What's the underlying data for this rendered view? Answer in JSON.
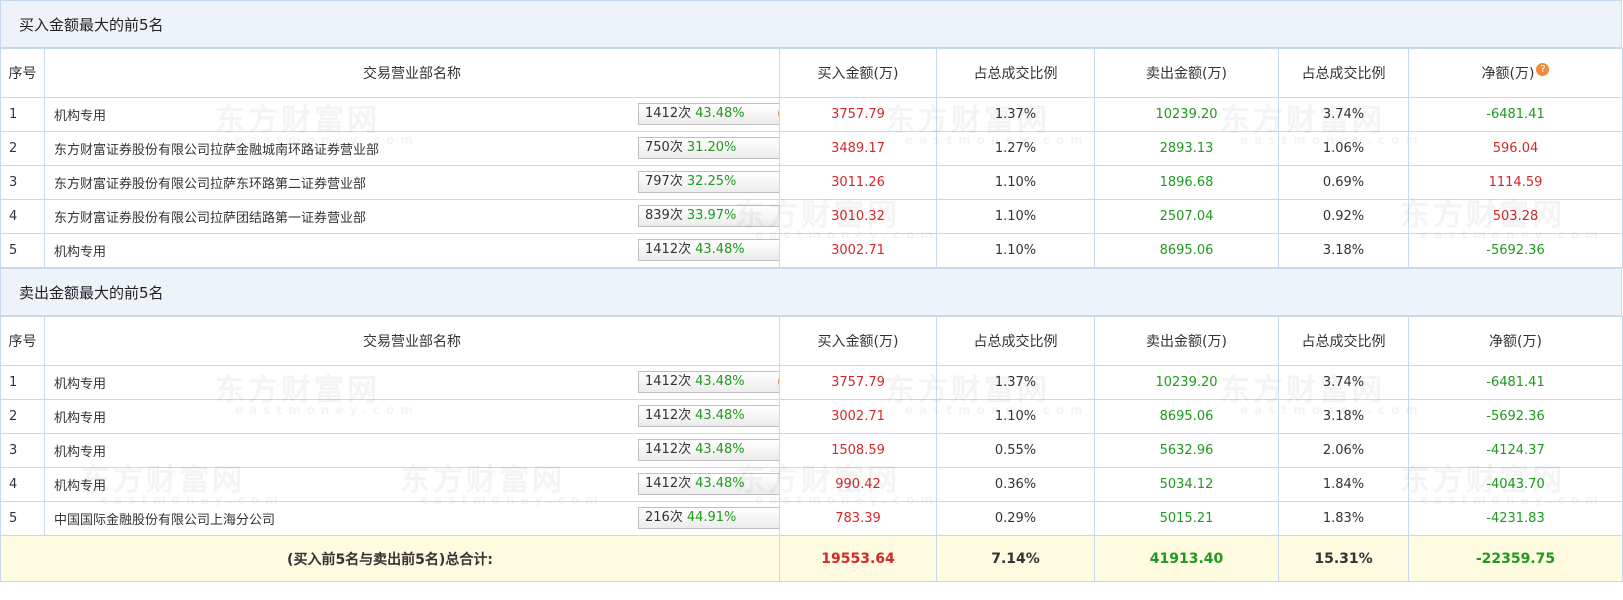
{
  "buy_section": {
    "title": "买入金额最大的前5名",
    "headers": [
      "序号",
      "交易营业部名称",
      "买入金额(万)",
      "占总成交比例",
      "卖出金额(万)",
      "占总成交比例",
      "净额(万)"
    ],
    "net_help_icon": "question-icon",
    "rows": [
      {
        "idx": "1",
        "name": "机构专用",
        "count": "1412次",
        "pct": "43.48%",
        "icon": "question-icon",
        "buy": "3757.79",
        "buy_ratio": "1.37%",
        "sell": "10239.20",
        "sell_ratio": "3.74%",
        "net": "-6481.41",
        "net_color": "green"
      },
      {
        "idx": "2",
        "name": "东方财富证券股份有限公司拉萨金融城南环路证券营业部",
        "count": "750次",
        "pct": "31.20%",
        "icon": "play-icon",
        "buy": "3489.17",
        "buy_ratio": "1.27%",
        "sell": "2893.13",
        "sell_ratio": "1.06%",
        "net": "596.04",
        "net_color": "red"
      },
      {
        "idx": "3",
        "name": "东方财富证券股份有限公司拉萨东环路第二证券营业部",
        "count": "797次",
        "pct": "32.25%",
        "icon": "play-icon",
        "buy": "3011.26",
        "buy_ratio": "1.10%",
        "sell": "1896.68",
        "sell_ratio": "0.69%",
        "net": "1114.59",
        "net_color": "red"
      },
      {
        "idx": "4",
        "name": "东方财富证券股份有限公司拉萨团结路第一证券营业部",
        "count": "839次",
        "pct": "33.97%",
        "icon": "play-icon",
        "buy": "3010.32",
        "buy_ratio": "1.10%",
        "sell": "2507.04",
        "sell_ratio": "0.92%",
        "net": "503.28",
        "net_color": "red"
      },
      {
        "idx": "5",
        "name": "机构专用",
        "count": "1412次",
        "pct": "43.48%",
        "icon": "play-icon",
        "buy": "3002.71",
        "buy_ratio": "1.10%",
        "sell": "8695.06",
        "sell_ratio": "3.18%",
        "net": "-5692.36",
        "net_color": "green"
      }
    ]
  },
  "sell_section": {
    "title": "卖出金额最大的前5名",
    "headers": [
      "序号",
      "交易营业部名称",
      "买入金额(万)",
      "占总成交比例",
      "卖出金额(万)",
      "占总成交比例",
      "净额(万)"
    ],
    "rows": [
      {
        "idx": "1",
        "name": "机构专用",
        "count": "1412次",
        "pct": "43.48%",
        "icon": "question-icon",
        "buy": "3757.79",
        "buy_ratio": "1.37%",
        "sell": "10239.20",
        "sell_ratio": "3.74%",
        "net": "-6481.41",
        "net_color": "green"
      },
      {
        "idx": "2",
        "name": "机构专用",
        "count": "1412次",
        "pct": "43.48%",
        "icon": "play-icon",
        "buy": "3002.71",
        "buy_ratio": "1.10%",
        "sell": "8695.06",
        "sell_ratio": "3.18%",
        "net": "-5692.36",
        "net_color": "green"
      },
      {
        "idx": "3",
        "name": "机构专用",
        "count": "1412次",
        "pct": "43.48%",
        "icon": "play-icon",
        "buy": "1508.59",
        "buy_ratio": "0.55%",
        "sell": "5632.96",
        "sell_ratio": "2.06%",
        "net": "-4124.37",
        "net_color": "green"
      },
      {
        "idx": "4",
        "name": "机构专用",
        "count": "1412次",
        "pct": "43.48%",
        "icon": "play-icon",
        "buy": "990.42",
        "buy_ratio": "0.36%",
        "sell": "5034.12",
        "sell_ratio": "1.84%",
        "net": "-4043.70",
        "net_color": "green"
      },
      {
        "idx": "5",
        "name": "中国国际金融股份有限公司上海分公司",
        "count": "216次",
        "pct": "44.91%",
        "icon": "play-icon",
        "buy": "783.39",
        "buy_ratio": "0.29%",
        "sell": "5015.21",
        "sell_ratio": "1.83%",
        "net": "-4231.83",
        "net_color": "green"
      }
    ]
  },
  "total": {
    "label": "(买入前5名与卖出前5名)总合计:",
    "buy": "19553.64",
    "buy_ratio": "7.14%",
    "sell": "41913.40",
    "sell_ratio": "15.31%",
    "net": "-22359.75"
  },
  "watermark": {
    "cn": "东方财富网",
    "en": "eastmoney.com"
  },
  "colors": {
    "red": "#d62828",
    "green": "#1e9b1e",
    "header_bg": "#eef3f9",
    "total_bg": "#fffbe0",
    "border": "#c9d9ec"
  }
}
